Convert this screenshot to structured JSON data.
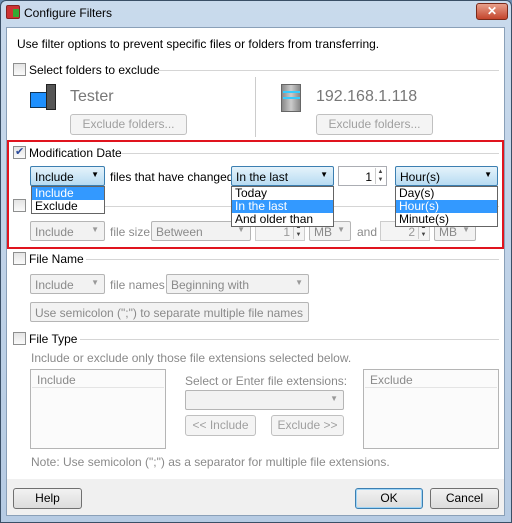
{
  "window": {
    "title": "Configure Filters",
    "close_label": "✕"
  },
  "intro": "Use filter options to prevent specific files or folders from transferring.",
  "folders": {
    "label": "Select folders to exclude",
    "checked": false,
    "local_name": "Tester",
    "remote_name": "192.168.1.118",
    "exclude_button": "Exclude folders..."
  },
  "modification": {
    "label": "Modification Date",
    "checked": true,
    "mode": "Include",
    "mode_options": [
      "Include",
      "Exclude"
    ],
    "mode_selected": "Include",
    "changed_text": "files that have changed",
    "range": "In the last",
    "range_options": [
      "Today",
      "In the last",
      "And older than"
    ],
    "range_selected": "In the last",
    "amount": "1",
    "unit": "Hour(s)",
    "unit_options": [
      "Day(s)",
      "Hour(s)",
      "Minute(s)"
    ],
    "unit_selected": "Hour(s)"
  },
  "filesize": {
    "checked": false,
    "mode": "Include",
    "text": "file size",
    "range": "Between",
    "from": "1",
    "from_unit": "MB",
    "and": "and",
    "to": "2",
    "to_unit": "MB"
  },
  "filename": {
    "label": "File Name",
    "checked": false,
    "mode": "Include",
    "text": "file names",
    "match": "Beginning with",
    "placeholder": "Use semicolon (\";\") to separate multiple file names"
  },
  "filetype": {
    "label": "File Type",
    "checked": false,
    "desc": "Include or exclude only those file extensions selected below.",
    "include_header": "Include",
    "select_label": "Select or Enter file extensions:",
    "include_button": "<< Include",
    "exclude_button": "Exclude >>",
    "exclude_header": "Exclude",
    "note": "Note: Use semicolon (\";\") as a separator for multiple file extensions."
  },
  "footer": {
    "help": "Help",
    "ok": "OK",
    "cancel": "Cancel"
  },
  "colors": {
    "highlight": "#3399ff",
    "annotation_box": "#e0141e"
  }
}
